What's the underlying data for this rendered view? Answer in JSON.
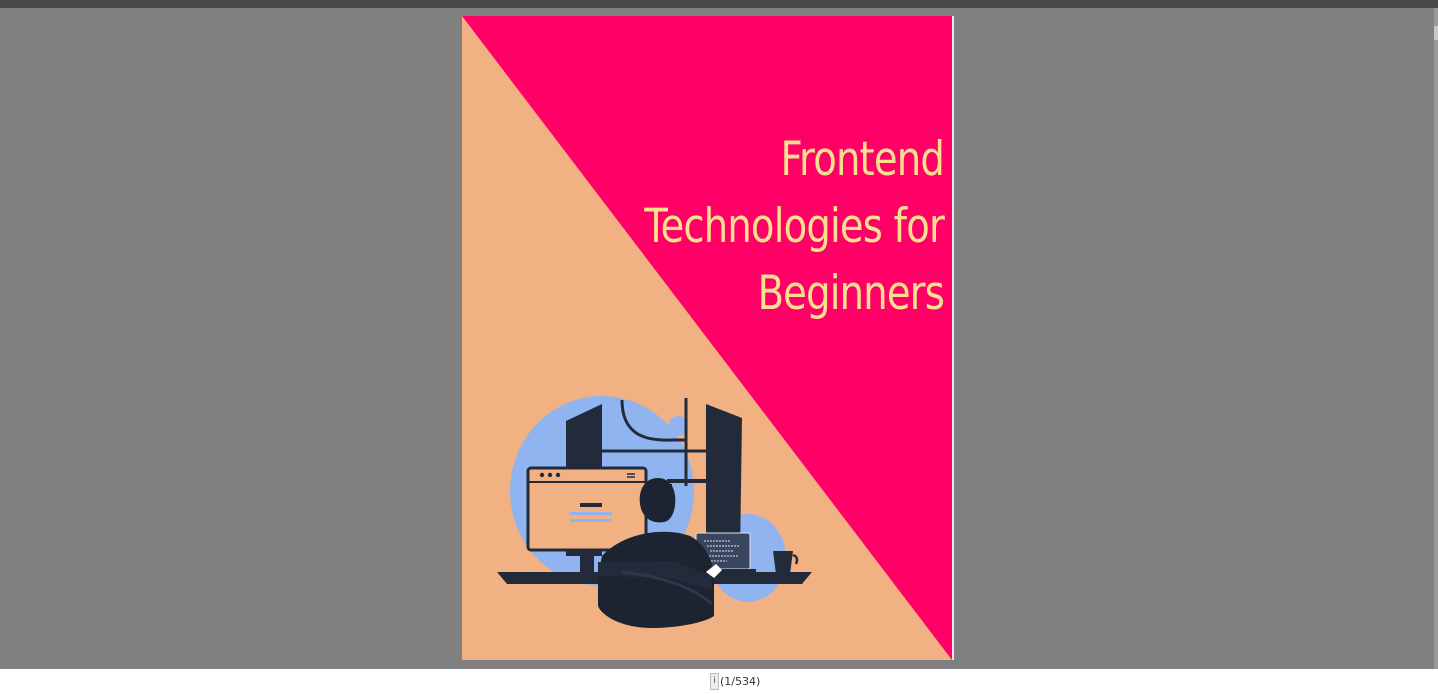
{
  "document": {
    "cover": {
      "title_lines": [
        "Frontend",
        "Technologies for",
        "Beginners"
      ],
      "colors": {
        "pink": "#ff0066",
        "peach": "#f2b183",
        "title": "#f7e08e",
        "navy": "#232b3b",
        "blue": "#8fb4f0"
      }
    }
  },
  "status": {
    "info_icon": "i",
    "page_indicator": "(1/534)"
  }
}
